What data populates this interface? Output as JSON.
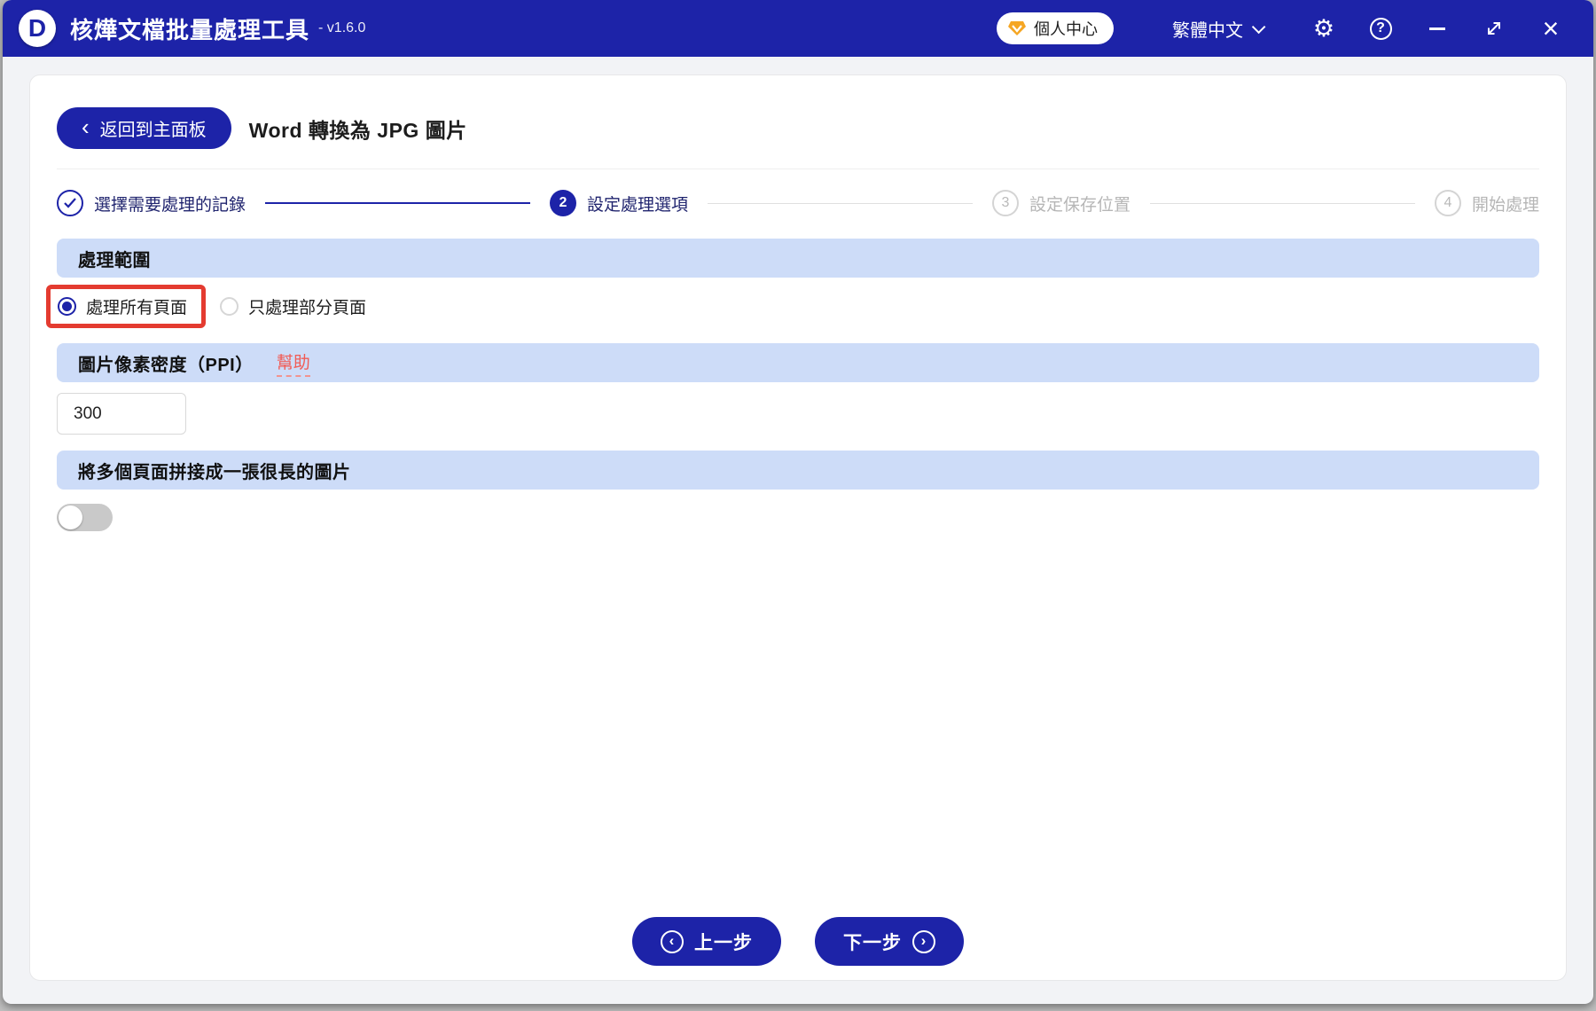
{
  "titlebar": {
    "logo_letter": "D",
    "app_title": "核燁文檔批量處理工具",
    "version": "- v1.6.0",
    "user_center_label": "個人中心",
    "language_label": "繁體中文",
    "icons": {
      "vip": "vip-gem-icon",
      "language_chevron": "chevron-down-icon",
      "settings": "gear-icon",
      "help": "help-circle-icon",
      "minimize": "minimize-icon",
      "resize": "resize-diagonal-icon",
      "close": "close-icon"
    }
  },
  "page": {
    "back_button_label": "返回到主面板",
    "title": "Word 轉換為 JPG 圖片"
  },
  "steps": [
    {
      "num": "1",
      "label": "選擇需要處理的記錄",
      "state": "done"
    },
    {
      "num": "2",
      "label": "設定處理選項",
      "state": "active"
    },
    {
      "num": "3",
      "label": "設定保存位置",
      "state": "pending"
    },
    {
      "num": "4",
      "label": "開始處理",
      "state": "pending"
    }
  ],
  "sections": {
    "range": {
      "title": "處理範圍",
      "options": [
        {
          "label": "處理所有頁面",
          "selected": true,
          "highlighted": true
        },
        {
          "label": "只處理部分頁面",
          "selected": false,
          "highlighted": false
        }
      ]
    },
    "ppi": {
      "title": "圖片像素密度（PPI）",
      "help_label": "幫助",
      "value": "300"
    },
    "stitch": {
      "title": "將多個頁面拼接成一張很長的圖片",
      "enabled": false
    }
  },
  "footer": {
    "prev_label": "上一步",
    "next_label": "下一步"
  },
  "colors": {
    "primary_blue": "#1d23a8",
    "section_bar_bg": "#cddcf8",
    "highlight_red": "#e43b30",
    "help_link_red": "#f15b55",
    "vip_gold": "#f5a623"
  }
}
